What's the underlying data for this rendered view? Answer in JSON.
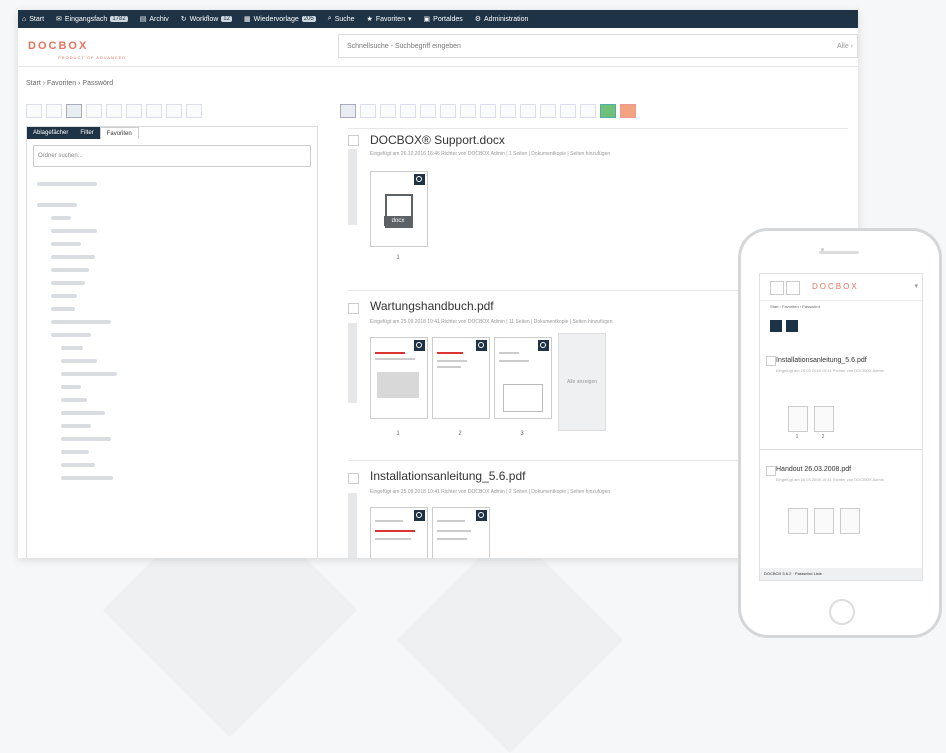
{
  "app": {
    "logo": "DOCBOX",
    "logo_sub": "PRODUCT OF ADVANCED"
  },
  "nav": {
    "items": [
      {
        "label": "Start",
        "icon": "home-icon"
      },
      {
        "label": "Eingangsfach",
        "icon": "inbox-icon",
        "badge": "1782"
      },
      {
        "label": "Archiv",
        "icon": "archive-icon"
      },
      {
        "label": "Workflow",
        "icon": "workflow-icon",
        "badge": "12"
      },
      {
        "label": "Wiedervorlage",
        "icon": "calendar-icon",
        "badge": "205"
      },
      {
        "label": "Suche",
        "icon": "search-icon"
      },
      {
        "label": "Favoriten",
        "icon": "star-icon"
      },
      {
        "label": "Portaldes",
        "icon": "portal-icon"
      },
      {
        "label": "Administration",
        "icon": "gear-icon"
      }
    ]
  },
  "search": {
    "placeholder": "Schnellsuche - Suchbegriff eingeben",
    "more": "Alle ›"
  },
  "breadcrumb": "Start  ›  Favoriten  ›  Passwörd",
  "left_panel": {
    "tabs": [
      "Ablagefächer",
      "Filter",
      "Favoriten"
    ],
    "filter_placeholder": "Ordner suchen..."
  },
  "documents": [
    {
      "title": "DOCBOX® Support.docx",
      "meta": "Eingefügt am 26.10.2016 16:46 Richter von DOCBOX Admin  |  1 Seiten  |  Dokumentkopie  |  Seiten hinzufügen",
      "file_ext": "docx",
      "pages": [
        "1"
      ]
    },
    {
      "title": "Wartungshandbuch.pdf",
      "meta": "Eingefügt am 25.09.2018 10:41 Richter von DOCBOX Admin  |  11 Seiten  |  Dokumentkopie  |  Seiten hinzufügen",
      "pages": [
        "1",
        "2",
        "3"
      ],
      "more_label": "Alle anzeigen"
    },
    {
      "title": "Installationsanleitung_5.6.pdf",
      "meta": "Eingefügt am 25.09.2018 10:41 Richter von DOCBOX Admin  |  2 Seiten  |  Dokumentkopie  |  Seiten hinzufügen",
      "pages": []
    }
  ],
  "phone": {
    "breadcrumb": "Start  ›  Favoriten  ›  Passwörd",
    "docs": [
      {
        "title": "Installationsanleitung_5.6.pdf",
        "meta": "Eingefügt am 25.09.2018 10:41 Richter von DOCBOX Admin",
        "pages": [
          "1",
          "2"
        ]
      },
      {
        "title": "Handout 26.03.2008.pdf",
        "meta": "Eingefügt am 26.03.2008 10:41 Richter von DOCBOX Admin",
        "pages": []
      }
    ],
    "footer": "DOCBOX 5.6.2 · Passwörd Liste"
  },
  "colors": {
    "nav_bg": "#1e3345",
    "brand": "#e3735e",
    "accent_green": "#6fc177",
    "accent_orange": "#f3a27f"
  }
}
